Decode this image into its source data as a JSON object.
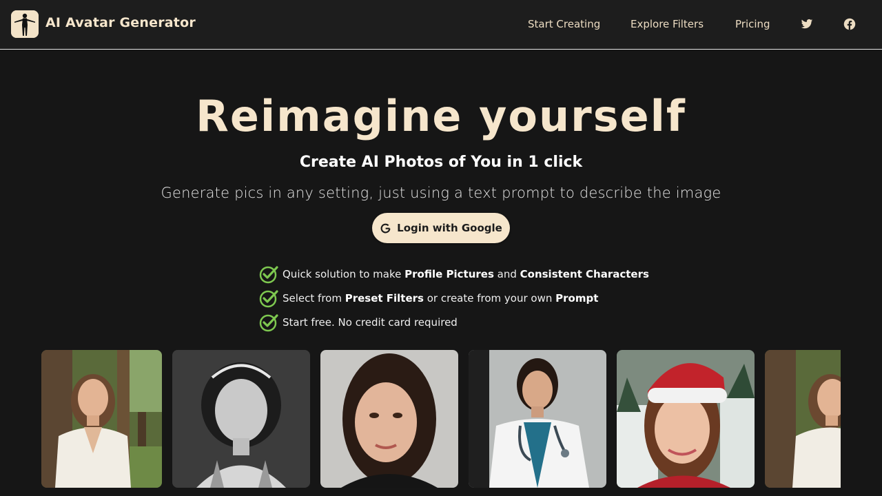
{
  "header": {
    "brand": "AI Avatar Generator",
    "logo_icon": "silhouette-logo-icon",
    "nav": [
      {
        "label": "Start Creating"
      },
      {
        "label": "Explore Filters"
      },
      {
        "label": "Pricing"
      }
    ],
    "social": [
      {
        "icon": "twitter-icon"
      },
      {
        "icon": "facebook-icon"
      }
    ]
  },
  "hero": {
    "title": "Reimagine yourself",
    "subtitle": "Create AI Photos of You in 1 click",
    "description": "Generate pics in any setting, just using a text prompt to describe the image",
    "login_label": "Login with Google",
    "login_icon": "google-icon"
  },
  "features": [
    {
      "parts": [
        {
          "text": "Quick solution to make ",
          "bold": false
        },
        {
          "text": "Profile Pictures",
          "bold": true
        },
        {
          "text": " and ",
          "bold": false
        },
        {
          "text": "Consistent Characters",
          "bold": true
        }
      ]
    },
    {
      "parts": [
        {
          "text": "Select from ",
          "bold": false
        },
        {
          "text": "Preset Filters",
          "bold": true
        },
        {
          "text": " or create from your own ",
          "bold": false
        },
        {
          "text": "Prompt",
          "bold": true
        }
      ]
    },
    {
      "parts": [
        {
          "text": "Start free. No credit card required",
          "bold": false
        }
      ]
    }
  ],
  "gallery": [
    {
      "name": "forest-portrait-photo"
    },
    {
      "name": "vintage-bw-portrait-photo"
    },
    {
      "name": "studio-headshot-photo"
    },
    {
      "name": "doctor-portrait-photo"
    },
    {
      "name": "santa-hat-portrait-photo"
    },
    {
      "name": "forest-portrait-photo-2"
    }
  ],
  "colors": {
    "accent": "#f6e6cc",
    "background": "#161616",
    "header_bg": "#1d1d1d",
    "check": "#7ec850"
  }
}
